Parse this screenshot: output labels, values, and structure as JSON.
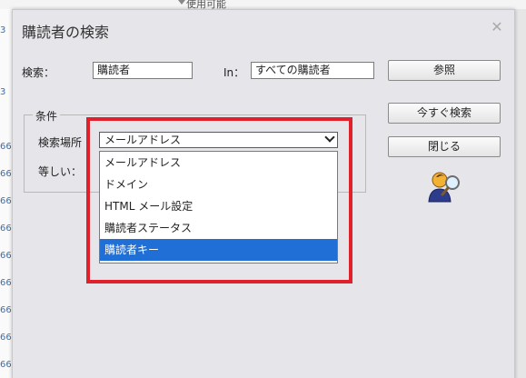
{
  "background": {
    "top_text": "使用可能",
    "left_rows": [
      "3",
      "3",
      "66",
      "66",
      "66",
      "66",
      "66",
      "66",
      "66",
      "66",
      "66"
    ]
  },
  "dialog": {
    "title": "購読者の検索",
    "close_icon": "close-icon",
    "search_label": "検索：",
    "search_value": "購読者",
    "in_label": "In：",
    "in_value": "すべての購読者",
    "browse_button": "参照",
    "search_now_button": "今すぐ検索",
    "close_button": "閉じる",
    "conditions_group": "条件",
    "search_location_label": "検索場所",
    "equals_label": "等しい：",
    "search_location_selected": "メールアドレス",
    "search_location_options": [
      "メールアドレス",
      "ドメイン",
      "HTML メール設定",
      "購読者ステータス",
      "購読者キー"
    ],
    "highlighted_option_index": 4,
    "highlight_color": "#1f6fd6",
    "annotation_color": "#e0202a",
    "icon": "subscriber-search-icon"
  }
}
